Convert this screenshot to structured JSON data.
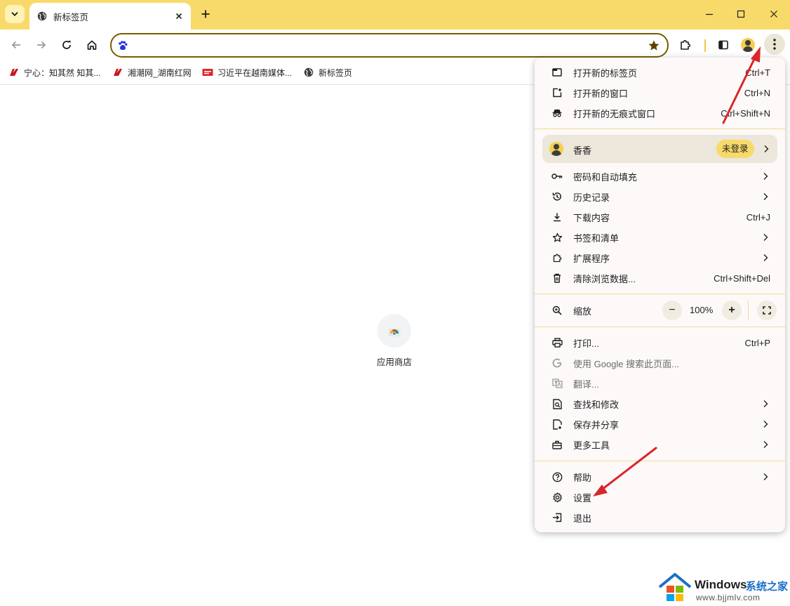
{
  "tab": {
    "title": "新标签页"
  },
  "omnibox": {
    "value": ""
  },
  "bookmarks": [
    {
      "label": "宁心：知其然 知其..."
    },
    {
      "label": "湘潮网_湖南红网"
    },
    {
      "label": "习近平在越南媒体..."
    },
    {
      "label": "新标签页"
    }
  ],
  "shortcut": {
    "label": "应用商店"
  },
  "menu": {
    "group1": [
      {
        "label": "打开新的标签页",
        "shortcut": "Ctrl+T"
      },
      {
        "label": "打开新的窗口",
        "shortcut": "Ctrl+N"
      },
      {
        "label": "打开新的无痕式窗口",
        "shortcut": "Ctrl+Shift+N"
      }
    ],
    "profile": {
      "name": "香香",
      "status": "未登录"
    },
    "group2": [
      {
        "label": "密码和自动填充",
        "shortcut": ""
      },
      {
        "label": "历史记录",
        "shortcut": ""
      },
      {
        "label": "下载内容",
        "shortcut": "Ctrl+J"
      },
      {
        "label": "书签和清单",
        "shortcut": ""
      },
      {
        "label": "扩展程序",
        "shortcut": ""
      },
      {
        "label": "清除浏览数据...",
        "shortcut": "Ctrl+Shift+Del"
      }
    ],
    "zoom": {
      "label": "缩放",
      "value": "100%",
      "minus": "−",
      "plus": "+"
    },
    "group3": [
      {
        "label": "打印...",
        "shortcut": "Ctrl+P"
      },
      {
        "label": "使用 Google 搜索此页面...",
        "shortcut": ""
      },
      {
        "label": "翻译...",
        "shortcut": ""
      },
      {
        "label": "查找和修改",
        "shortcut": ""
      },
      {
        "label": "保存并分享",
        "shortcut": ""
      },
      {
        "label": "更多工具",
        "shortcut": ""
      }
    ],
    "group4": [
      {
        "label": "帮助"
      },
      {
        "label": "设置"
      },
      {
        "label": "退出"
      }
    ]
  },
  "watermark": {
    "brand": "Windows",
    "site_cn": "系统之家",
    "url": "www.bjjmlv.com"
  },
  "colors": {
    "accent": "#f8da6a",
    "arrow": "#d9262b",
    "omnibox_border": "#7a5c00"
  }
}
